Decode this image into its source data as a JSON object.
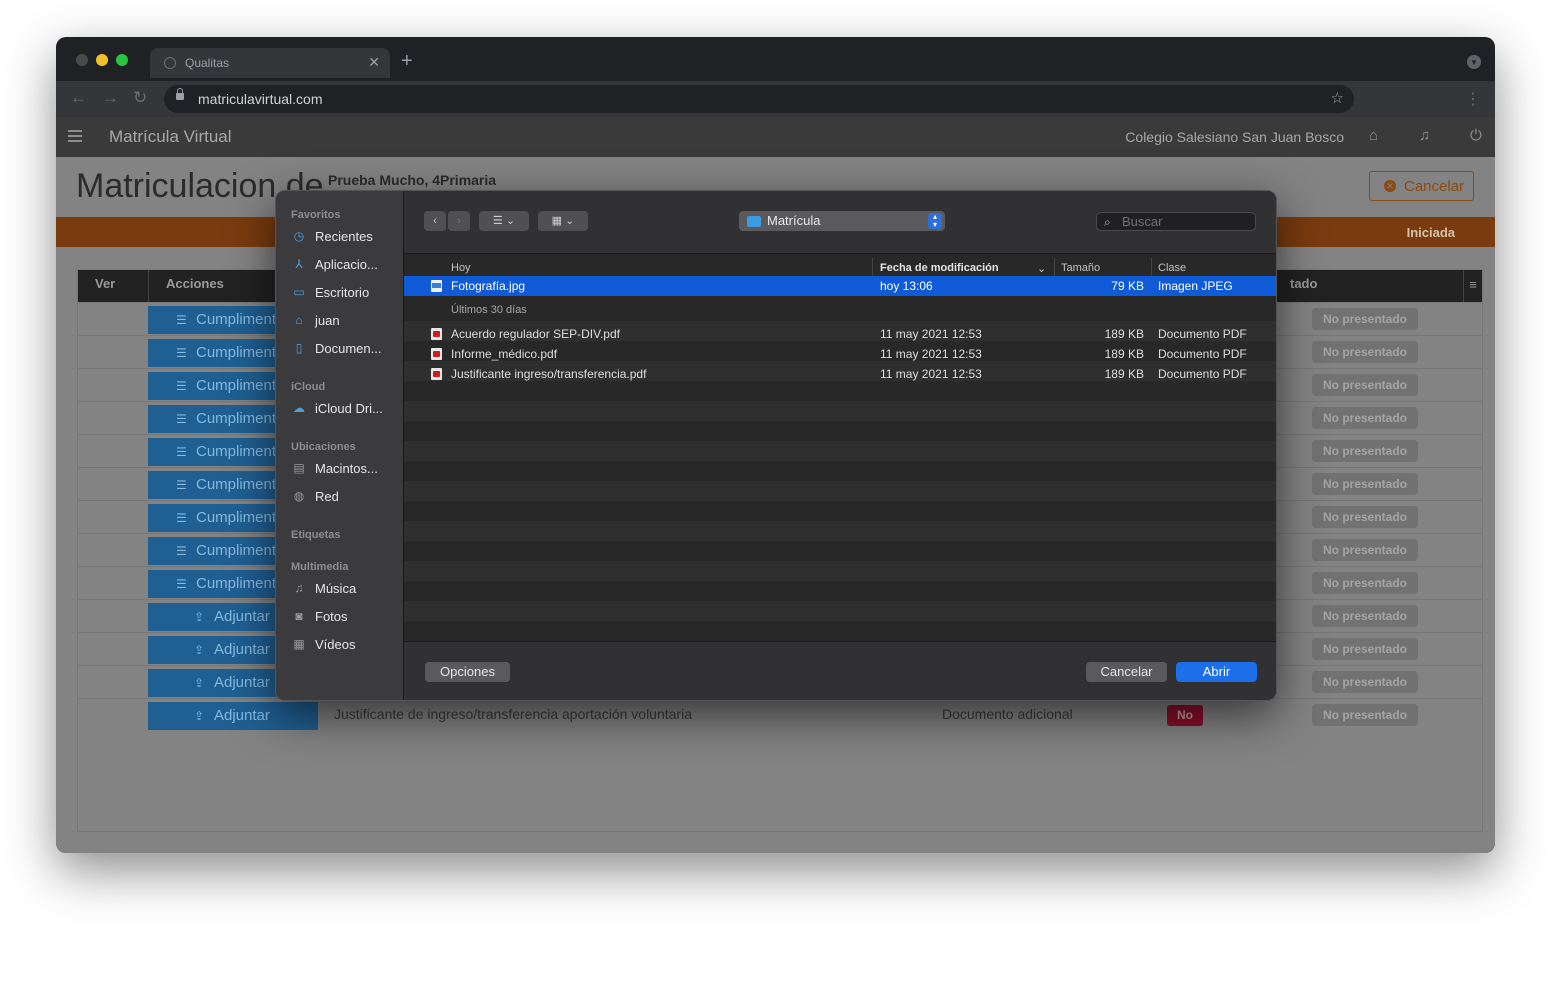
{
  "browser": {
    "tab_title": "Qualitas",
    "url": "matriculavirtual.com"
  },
  "site": {
    "brand": "Matrícula Virtual",
    "school": "Colegio Salesiano San Juan Bosco"
  },
  "page": {
    "title": "Matriculacion de",
    "student": "Prueba Mucho, 4Primaria",
    "cancel_label": "Cancelar",
    "status": "Iniciada"
  },
  "table": {
    "headers": {
      "ver": "Ver",
      "acciones": "Acciones",
      "estado_partial": "tado"
    },
    "rows": [
      {
        "action": "Cumplimentar",
        "status": "No presentado"
      },
      {
        "action": "Cumplimentar",
        "status": "No presentado"
      },
      {
        "action": "Cumplimentar",
        "status": "No presentado"
      },
      {
        "action": "Cumplimentar",
        "status": "No presentado"
      },
      {
        "action": "Cumplimentar",
        "status": "No presentado"
      },
      {
        "action": "Cumplimentar",
        "status": "No presentado"
      },
      {
        "action": "Cumplimentar",
        "status": "No presentado"
      },
      {
        "action": "Cumplimentar",
        "status": "No presentado"
      },
      {
        "action": "Cumplimentar",
        "status": "No presentado"
      },
      {
        "action": "Adjuntar",
        "status": "No presentado"
      },
      {
        "action": "Adjuntar",
        "status": "No presentado"
      },
      {
        "action": "Adjuntar",
        "status": "No presentado"
      },
      {
        "action": "Adjuntar",
        "status": "No presentado",
        "description": "Justificante de ingreso/transferencia aportación voluntaria",
        "doc_type": "Documento adicional",
        "required": "No"
      }
    ]
  },
  "dialog": {
    "sidebar": {
      "favoritos": "Favoritos",
      "recientes": "Recientes",
      "aplicaciones": "Aplicacio...",
      "escritorio": "Escritorio",
      "juan": "juan",
      "documentos": "Documen...",
      "icloud": "iCloud",
      "icloud_drive": "iCloud Dri...",
      "ubicaciones": "Ubicaciones",
      "macintosh": "Macintos...",
      "red": "Red",
      "etiquetas": "Etiquetas",
      "multimedia": "Multimedia",
      "musica": "Música",
      "fotos": "Fotos",
      "videos": "Vídeos"
    },
    "folder": "Matrícula",
    "search_placeholder": "Buscar",
    "columns": {
      "name": "Hoy",
      "date": "Fecha de modificación",
      "size": "Tamaño",
      "kind": "Clase"
    },
    "groups": {
      "today": "Hoy",
      "last30": "Últimos 30 días"
    },
    "files": [
      {
        "name": "Fotografía.jpg",
        "date": "hoy 13:06",
        "size": "79 KB",
        "kind": "Imagen JPEG"
      },
      {
        "name": "Acuerdo regulador SEP-DIV.pdf",
        "date": "11 may 2021 12:53",
        "size": "189 KB",
        "kind": "Documento PDF"
      },
      {
        "name": "Informe_médico.pdf",
        "date": "11 may 2021 12:53",
        "size": "189 KB",
        "kind": "Documento PDF"
      },
      {
        "name": "Justificante ingreso/transferencia.pdf",
        "date": "11 may 2021 12:53",
        "size": "189 KB",
        "kind": "Documento PDF"
      }
    ],
    "options_label": "Opciones",
    "cancel_label": "Cancelar",
    "open_label": "Abrir"
  }
}
